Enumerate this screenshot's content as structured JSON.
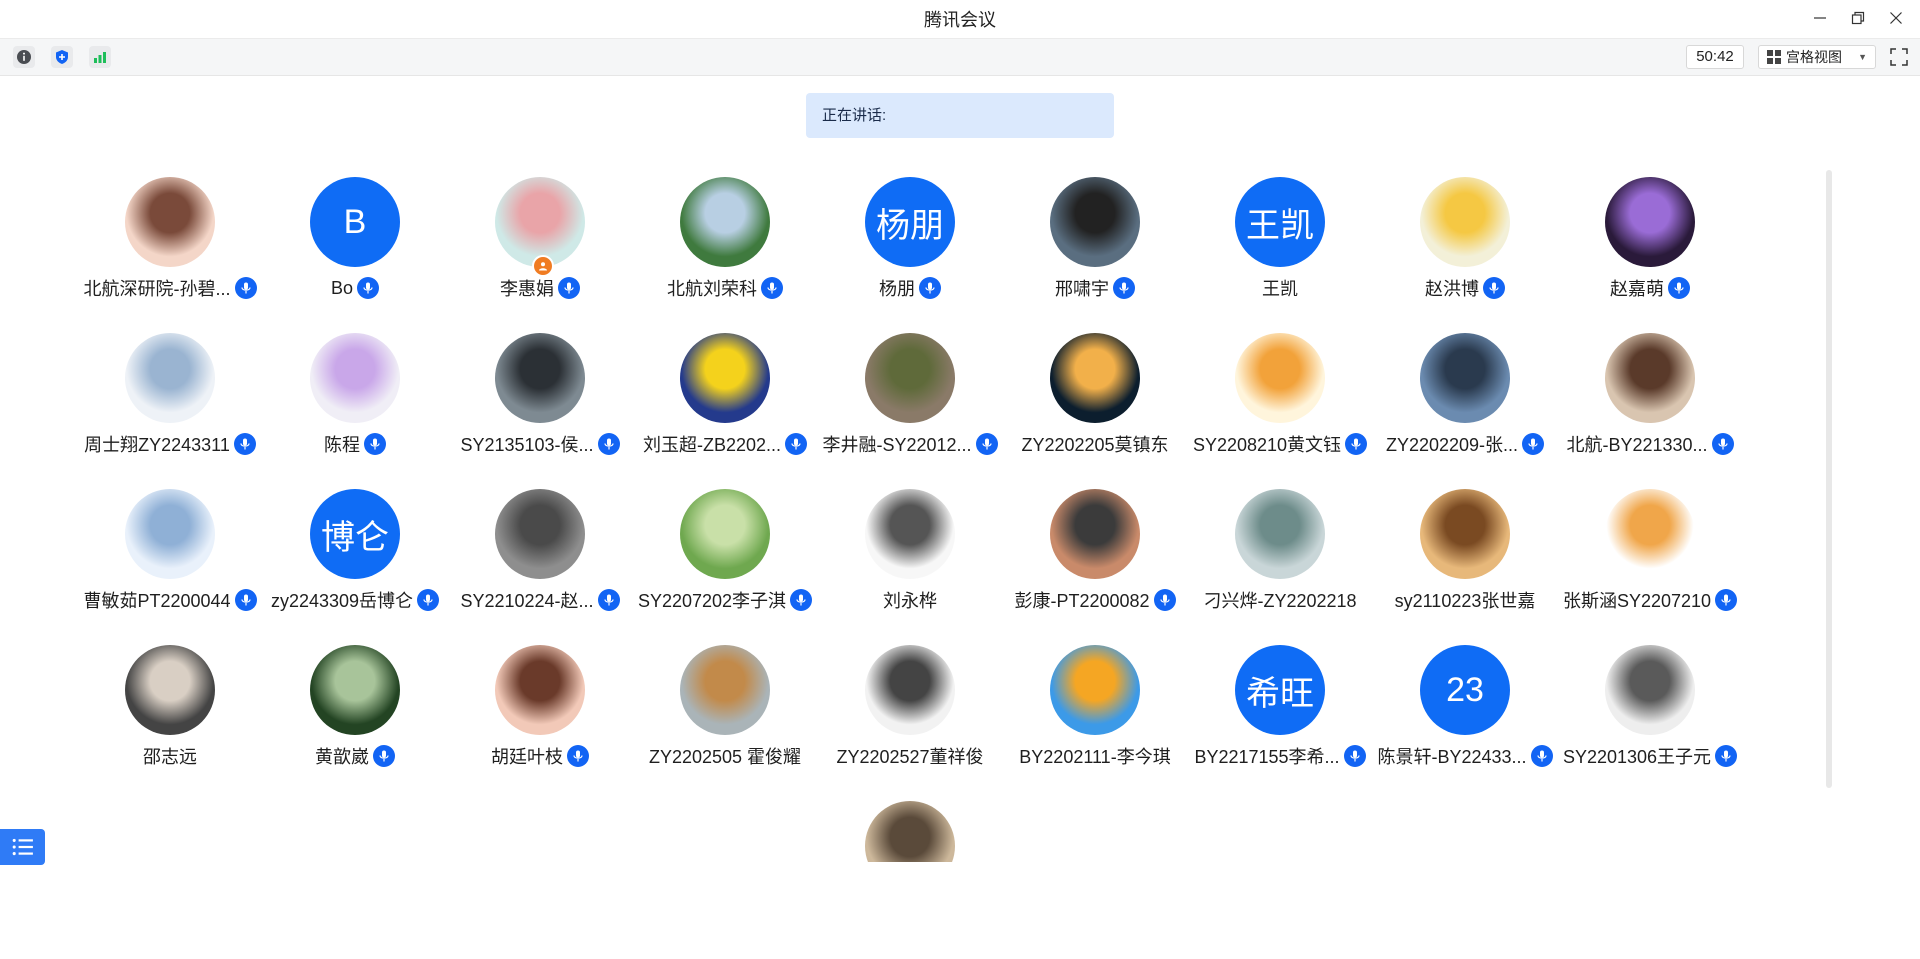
{
  "window": {
    "title": "腾讯会议"
  },
  "toolbar": {
    "timer": "50:42",
    "view_label": "宫格视图"
  },
  "speaking": {
    "label": "正在讲话:"
  },
  "colors": {
    "accent": "#0f6cf5",
    "banner": "#dbe9fd",
    "host": "#f07c22"
  },
  "participants": [
    {
      "name": "北航深研院-孙碧...",
      "avatar": "photo",
      "mic": true
    },
    {
      "name": "Bo",
      "avatar": "letter",
      "initial": "B",
      "mic": true
    },
    {
      "name": "李惠娟",
      "avatar": "photo",
      "mic": true,
      "host": true
    },
    {
      "name": "北航刘荣科",
      "avatar": "photo",
      "mic": true
    },
    {
      "name": "杨朋",
      "avatar": "letter",
      "initial": "杨朋",
      "mic": true
    },
    {
      "name": "邢啸宇",
      "avatar": "photo",
      "mic": true
    },
    {
      "name": "王凯",
      "avatar": "letter",
      "initial": "王凯",
      "mic": false
    },
    {
      "name": "赵洪博",
      "avatar": "photo",
      "mic": true
    },
    {
      "name": "赵嘉萌",
      "avatar": "photo",
      "mic": true
    },
    {
      "name": "周士翔ZY2243311",
      "avatar": "photo",
      "mic": true
    },
    {
      "name": "陈程",
      "avatar": "photo",
      "mic": true
    },
    {
      "name": "SY2135103-侯...",
      "avatar": "photo",
      "mic": true
    },
    {
      "name": "刘玉超-ZB2202...",
      "avatar": "photo",
      "mic": true
    },
    {
      "name": "李井融-SY22012...",
      "avatar": "photo",
      "mic": true
    },
    {
      "name": "ZY2202205莫镇东",
      "avatar": "photo",
      "mic": false
    },
    {
      "name": "SY2208210黄文钰",
      "avatar": "photo",
      "mic": true
    },
    {
      "name": "ZY2202209-张...",
      "avatar": "photo",
      "mic": true
    },
    {
      "name": "北航-BY221330...",
      "avatar": "photo",
      "mic": true
    },
    {
      "name": "曹敏茹PT2200044",
      "avatar": "photo",
      "mic": true
    },
    {
      "name": "zy2243309岳博仑",
      "avatar": "letter",
      "initial": "博仑",
      "mic": true
    },
    {
      "name": "SY2210224-赵...",
      "avatar": "photo",
      "mic": true
    },
    {
      "name": "SY2207202李子淇",
      "avatar": "photo",
      "mic": true
    },
    {
      "name": "刘永桦",
      "avatar": "photo",
      "mic": false
    },
    {
      "name": "彭康-PT2200082",
      "avatar": "photo",
      "mic": true
    },
    {
      "name": "刁兴烨-ZY2202218",
      "avatar": "photo",
      "mic": false
    },
    {
      "name": "sy2110223张世嘉",
      "avatar": "photo",
      "mic": false
    },
    {
      "name": "张斯涵SY2207210",
      "avatar": "photo",
      "mic": true
    },
    {
      "name": "邵志远",
      "avatar": "photo",
      "mic": false
    },
    {
      "name": "黄歆崴",
      "avatar": "photo",
      "mic": true
    },
    {
      "name": "胡廷叶枝",
      "avatar": "photo",
      "mic": true
    },
    {
      "name": "ZY2202505 霍俊耀",
      "avatar": "photo",
      "mic": false
    },
    {
      "name": "ZY2202527董祥俊",
      "avatar": "photo",
      "mic": false
    },
    {
      "name": "BY2202111-李今琪",
      "avatar": "photo",
      "mic": false
    },
    {
      "name": "BY2217155李希...",
      "avatar": "letter",
      "initial": "希旺",
      "mic": true
    },
    {
      "name": "陈景轩-BY22433...",
      "avatar": "letter",
      "initial": "23",
      "mic": true
    },
    {
      "name": "SY2201306王子元",
      "avatar": "photo",
      "mic": true
    },
    {
      "name": "",
      "avatar": "photo",
      "mic": false
    }
  ]
}
